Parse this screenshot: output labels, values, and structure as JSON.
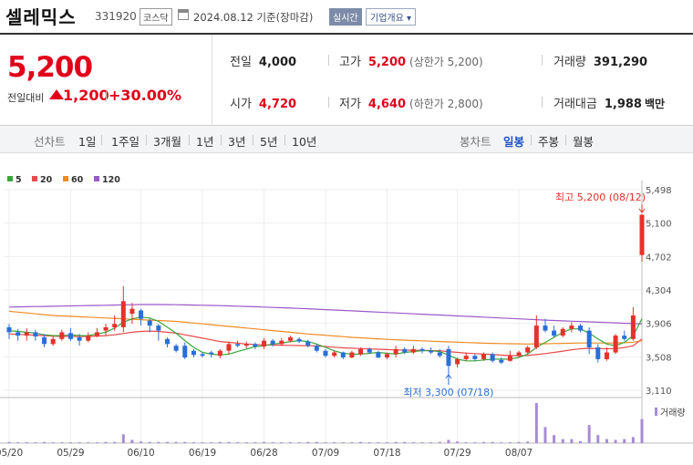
{
  "header": {
    "name": "셀레믹스",
    "code": "331920",
    "market": "코스닥",
    "date_text": "2024.08.12 기준(장마감)",
    "realtime_label": "실시간",
    "company_info_label": "기업개요 ▾"
  },
  "summary": {
    "price": "5,200",
    "change_label": "전일대비",
    "change": "1,200",
    "change_pct": "+30.00%",
    "prev_close_label": "전일",
    "prev_close": "4,000",
    "high_label": "고가",
    "high": "5,200",
    "upper_limit": "(상한가 5,200)",
    "volume_label": "거래량",
    "volume": "391,290",
    "open_label": "시가",
    "open": "4,720",
    "low_label": "저가",
    "low": "4,640",
    "lower_limit": "(하한가 2,800)",
    "amount_label": "거래대금",
    "amount": "1,988",
    "amount_unit": "백만"
  },
  "periods": {
    "line_label": "선차트",
    "items": [
      "1일",
      "1주일",
      "3개월",
      "1년",
      "3년",
      "5년",
      "10년"
    ],
    "candle_label": "봉차트",
    "candle_items": [
      "일봉",
      "주봉",
      "월봉"
    ]
  },
  "chart_data": {
    "type": "candlestick",
    "legend": [
      {
        "name": "5",
        "color": "#3aa63a"
      },
      {
        "name": "20",
        "color": "#e84a4a"
      },
      {
        "name": "60",
        "color": "#f08a24"
      },
      {
        "name": "120",
        "color": "#9b59c9"
      }
    ],
    "y_ticks": [
      3110,
      3508,
      3906,
      4304,
      4702,
      5100,
      5498
    ],
    "y_tick_labels": [
      "3,110",
      "3,508",
      "3,906",
      "4,304",
      "4,702",
      "5,100",
      "5,498"
    ],
    "x_labels": [
      "05/20",
      "05/29",
      "06/10",
      "06/19",
      "06/28",
      "07/09",
      "07/18",
      "07/29",
      "08/07"
    ],
    "x_label_index": [
      0,
      7,
      15,
      22,
      29,
      36,
      43,
      51,
      58
    ],
    "ylim": [
      3110,
      5498
    ],
    "candles": [
      [
        3860,
        3800,
        3900,
        3720
      ],
      [
        3800,
        3760,
        3840,
        3700
      ],
      [
        3760,
        3800,
        3850,
        3700
      ],
      [
        3800,
        3750,
        3830,
        3700
      ],
      [
        3740,
        3660,
        3780,
        3620
      ],
      [
        3660,
        3720,
        3760,
        3640
      ],
      [
        3720,
        3800,
        3830,
        3700
      ],
      [
        3790,
        3720,
        3850,
        3700
      ],
      [
        3740,
        3700,
        3780,
        3640
      ],
      [
        3700,
        3760,
        3800,
        3680
      ],
      [
        3760,
        3800,
        3850,
        3740
      ],
      [
        3820,
        3860,
        3900,
        3760
      ],
      [
        3860,
        3900,
        4000,
        3820
      ],
      [
        3860,
        4170,
        4350,
        3800
      ],
      [
        4020,
        4080,
        4150,
        3900
      ],
      [
        4060,
        3960,
        4080,
        3880
      ],
      [
        3940,
        3880,
        3960,
        3800
      ],
      [
        3880,
        3820,
        3900,
        3700
      ],
      [
        3720,
        3660,
        3740,
        3620
      ],
      [
        3640,
        3580,
        3660,
        3560
      ],
      [
        3640,
        3500,
        3680,
        3480
      ],
      [
        3580,
        3530,
        3600,
        3500
      ],
      [
        3540,
        3520,
        3560,
        3500
      ],
      [
        3560,
        3540,
        3580,
        3500
      ],
      [
        3520,
        3580,
        3600,
        3490
      ],
      [
        3580,
        3660,
        3690,
        3540
      ],
      [
        3660,
        3640,
        3700,
        3620
      ],
      [
        3640,
        3660,
        3690,
        3610
      ],
      [
        3660,
        3630,
        3680,
        3600
      ],
      [
        3630,
        3700,
        3730,
        3600
      ],
      [
        3700,
        3660,
        3720,
        3630
      ],
      [
        3660,
        3700,
        3730,
        3640
      ],
      [
        3700,
        3740,
        3760,
        3680
      ],
      [
        3720,
        3690,
        3740,
        3670
      ],
      [
        3690,
        3640,
        3710,
        3620
      ],
      [
        3640,
        3580,
        3660,
        3560
      ],
      [
        3580,
        3520,
        3600,
        3500
      ],
      [
        3520,
        3560,
        3580,
        3500
      ],
      [
        3560,
        3500,
        3570,
        3480
      ],
      [
        3500,
        3560,
        3580,
        3490
      ],
      [
        3540,
        3600,
        3620,
        3520
      ],
      [
        3600,
        3560,
        3620,
        3540
      ],
      [
        3560,
        3500,
        3580,
        3490
      ],
      [
        3500,
        3540,
        3560,
        3480
      ],
      [
        3540,
        3600,
        3640,
        3500
      ],
      [
        3600,
        3560,
        3620,
        3540
      ],
      [
        3560,
        3600,
        3640,
        3540
      ],
      [
        3600,
        3580,
        3620,
        3550
      ],
      [
        3580,
        3560,
        3620,
        3540
      ],
      [
        3560,
        3520,
        3600,
        3500
      ],
      [
        3600,
        3400,
        3640,
        3300
      ],
      [
        3420,
        3480,
        3500,
        3380
      ],
      [
        3480,
        3520,
        3560,
        3460
      ],
      [
        3520,
        3480,
        3540,
        3460
      ],
      [
        3480,
        3540,
        3560,
        3460
      ],
      [
        3540,
        3460,
        3560,
        3440
      ],
      [
        3470,
        3440,
        3500,
        3420
      ],
      [
        3460,
        3520,
        3580,
        3450
      ],
      [
        3520,
        3560,
        3580,
        3500
      ],
      [
        3560,
        3620,
        3640,
        3540
      ],
      [
        3620,
        3880,
        4000,
        3600
      ],
      [
        3880,
        3820,
        3960,
        3800
      ],
      [
        3820,
        3760,
        3880,
        3740
      ],
      [
        3760,
        3840,
        3860,
        3740
      ],
      [
        3840,
        3880,
        3920,
        3800
      ],
      [
        3880,
        3820,
        3900,
        3800
      ],
      [
        3820,
        3620,
        3860,
        3540
      ],
      [
        3620,
        3480,
        3660,
        3440
      ],
      [
        3480,
        3560,
        3620,
        3460
      ],
      [
        3560,
        3760,
        3780,
        3540
      ],
      [
        3760,
        3720,
        3820,
        3700
      ],
      [
        3720,
        4000,
        4100,
        3700
      ],
      [
        4720,
        5200,
        5200,
        4640
      ]
    ],
    "ma5": [
      3820,
      3810,
      3800,
      3790,
      3770,
      3760,
      3760,
      3770,
      3760,
      3760,
      3780,
      3800,
      3850,
      3920,
      3960,
      3980,
      3970,
      3930,
      3860,
      3790,
      3700,
      3620,
      3560,
      3540,
      3530,
      3540,
      3570,
      3600,
      3630,
      3640,
      3660,
      3670,
      3690,
      3700,
      3690,
      3660,
      3620,
      3580,
      3550,
      3540,
      3540,
      3550,
      3560,
      3550,
      3540,
      3560,
      3570,
      3580,
      3580,
      3570,
      3530,
      3480,
      3460,
      3460,
      3470,
      3480,
      3480,
      3480,
      3500,
      3540,
      3620,
      3680,
      3740,
      3800,
      3840,
      3840,
      3790,
      3720,
      3660,
      3640,
      3680,
      3760,
      3960
    ],
    "ma20": [
      3780,
      3775,
      3770,
      3765,
      3760,
      3755,
      3750,
      3750,
      3750,
      3750,
      3755,
      3760,
      3770,
      3785,
      3800,
      3810,
      3815,
      3810,
      3800,
      3790,
      3770,
      3750,
      3730,
      3710,
      3690,
      3680,
      3670,
      3660,
      3655,
      3650,
      3648,
      3646,
      3644,
      3642,
      3640,
      3638,
      3630,
      3622,
      3615,
      3610,
      3606,
      3602,
      3598,
      3594,
      3590,
      3588,
      3586,
      3584,
      3582,
      3580,
      3570,
      3560,
      3552,
      3546,
      3540,
      3534,
      3528,
      3524,
      3522,
      3524,
      3534,
      3546,
      3560,
      3576,
      3592,
      3604,
      3608,
      3606,
      3604,
      3606,
      3618,
      3640,
      3720
    ],
    "ma60": [
      4050,
      4040,
      4030,
      4020,
      4010,
      4000,
      3995,
      3990,
      3985,
      3980,
      3975,
      3970,
      3965,
      3960,
      3955,
      3950,
      3945,
      3940,
      3935,
      3930,
      3920,
      3910,
      3900,
      3890,
      3880,
      3870,
      3860,
      3850,
      3840,
      3830,
      3820,
      3810,
      3800,
      3790,
      3780,
      3772,
      3764,
      3756,
      3748,
      3740,
      3734,
      3728,
      3722,
      3716,
      3710,
      3706,
      3702,
      3698,
      3694,
      3690,
      3686,
      3682,
      3678,
      3674,
      3670,
      3668,
      3666,
      3664,
      3662,
      3660,
      3662,
      3664,
      3666,
      3668,
      3670,
      3672,
      3672,
      3672,
      3672,
      3672,
      3676,
      3682,
      3700
    ],
    "ma120": [
      4100,
      4102,
      4104,
      4106,
      4108,
      4110,
      4112,
      4114,
      4116,
      4118,
      4120,
      4122,
      4124,
      4126,
      4128,
      4130,
      4130,
      4130,
      4129,
      4128,
      4126,
      4124,
      4122,
      4120,
      4117,
      4114,
      4111,
      4108,
      4104,
      4100,
      4096,
      4092,
      4088,
      4084,
      4080,
      4075,
      4070,
      4065,
      4060,
      4055,
      4050,
      4045,
      4040,
      4035,
      4030,
      4025,
      4020,
      4015,
      4010,
      4005,
      4000,
      3995,
      3990,
      3985,
      3980,
      3975,
      3970,
      3965,
      3960,
      3955,
      3950,
      3945,
      3940,
      3936,
      3932,
      3928,
      3924,
      3920,
      3916,
      3912,
      3908,
      3904,
      3900
    ],
    "volume": [
      3,
      2,
      2,
      2,
      3,
      2,
      2,
      2,
      2,
      2,
      2,
      3,
      3,
      22,
      8,
      4,
      3,
      3,
      3,
      3,
      3,
      2,
      2,
      2,
      3,
      3,
      2,
      2,
      2,
      3,
      2,
      2,
      2,
      2,
      3,
      3,
      2,
      2,
      2,
      2,
      3,
      2,
      2,
      2,
      3,
      3,
      2,
      2,
      2,
      3,
      8,
      4,
      2,
      2,
      3,
      3,
      2,
      2,
      3,
      4,
      100,
      40,
      20,
      10,
      10,
      5,
      45,
      20,
      10,
      8,
      10,
      15,
      60
    ],
    "annotation_high": "최고 5,200 (08/12)",
    "annotation_low": "최저 3,300 (07/18)",
    "volume_label": "거래량"
  }
}
